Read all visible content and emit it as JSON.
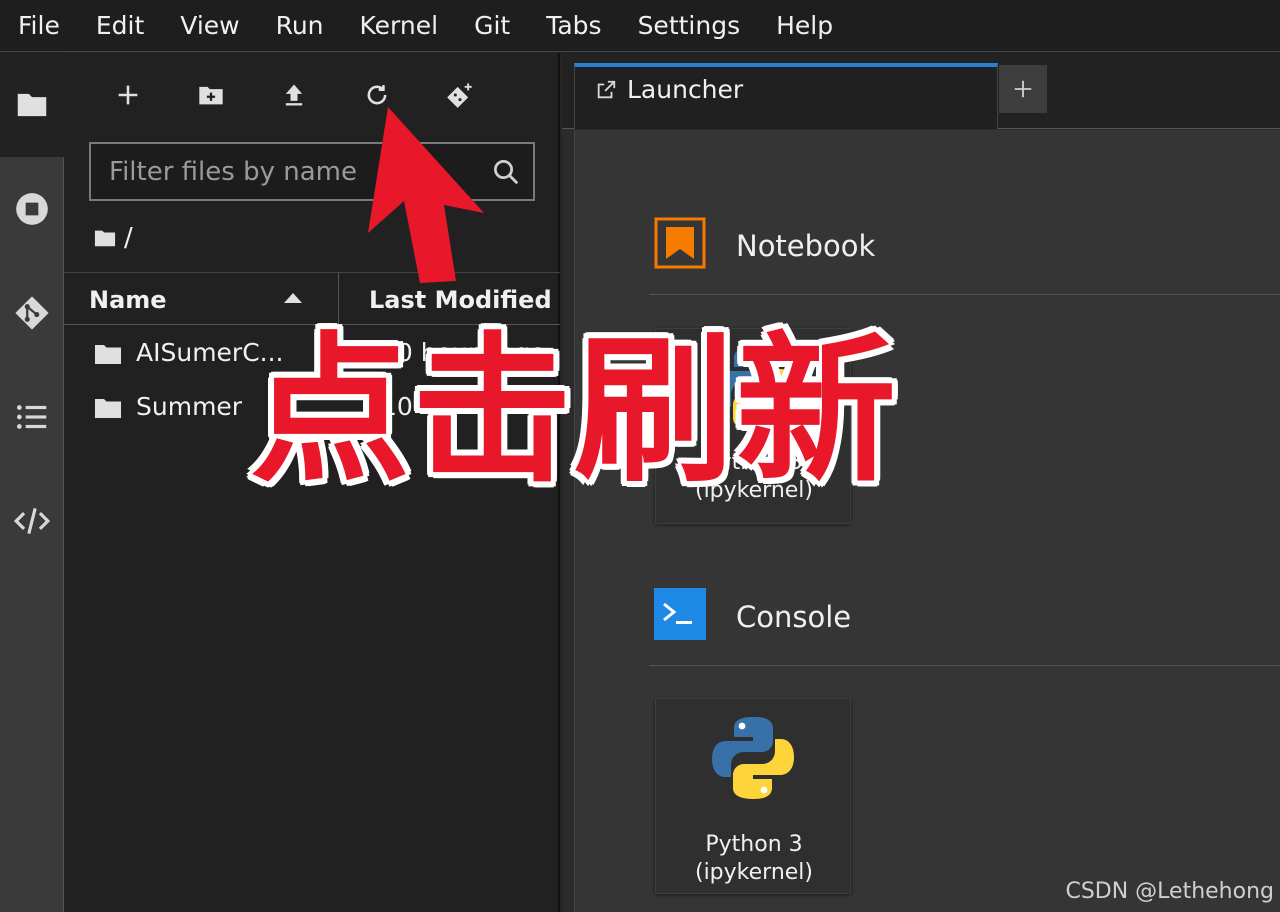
{
  "menubar": {
    "items": [
      "File",
      "Edit",
      "View",
      "Run",
      "Kernel",
      "Git",
      "Tabs",
      "Settings",
      "Help"
    ]
  },
  "activity_bar": {
    "icons": [
      "folder-icon",
      "running-stop-icon",
      "git-icon",
      "table-of-contents-icon",
      "code-snippets-icon"
    ]
  },
  "file_browser": {
    "toolbar_icons": [
      "new-launcher-plus-icon",
      "new-folder-icon",
      "upload-icon",
      "refresh-icon",
      "git-clone-icon"
    ],
    "filter_placeholder": "Filter files by name",
    "breadcrumb_root": "/",
    "columns": {
      "name": "Name",
      "modified": "Last Modified"
    },
    "files": [
      {
        "name": "AISumerC...",
        "modified": "10 hours ago",
        "type": "folder"
      },
      {
        "name": "Summer",
        "modified": "10",
        "type": "folder"
      }
    ]
  },
  "tabs": {
    "active_label": "Launcher"
  },
  "launcher": {
    "sections": [
      {
        "title": "Notebook",
        "cards": [
          {
            "label_line1": "Python 3",
            "label_line2": "(ipykernel)"
          }
        ]
      },
      {
        "title": "Console",
        "cards": [
          {
            "label_line1": "Python 3",
            "label_line2": "(ipykernel)"
          }
        ]
      }
    ]
  },
  "overlay": {
    "caption": "点击刷新",
    "watermark": "CSDN @Lethehong"
  },
  "colors": {
    "accent_tab": "#2a7fd4",
    "notebook_icon": "#f57c00",
    "console_icon": "#1e88e5",
    "annotation_red": "#e8182a"
  }
}
